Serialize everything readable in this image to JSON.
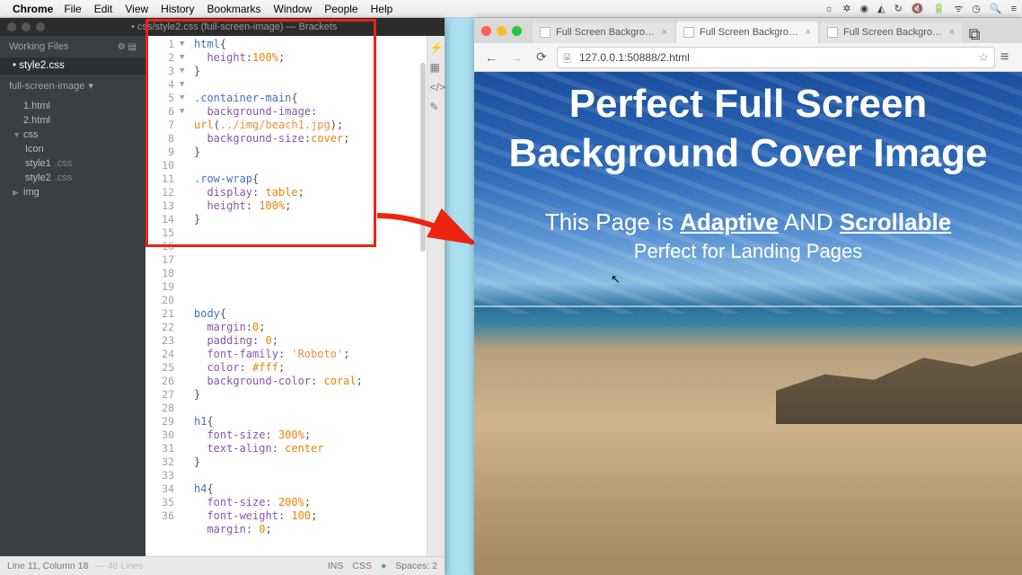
{
  "menubar": {
    "appname": "Chrome",
    "items": [
      "File",
      "Edit",
      "View",
      "History",
      "Bookmarks",
      "Window",
      "People",
      "Help"
    ]
  },
  "brackets": {
    "title": "• css/style2.css (full-screen-image) — Brackets",
    "workingFilesLabel": "Working Files",
    "workingFiles": [
      {
        "name": "style2.css",
        "modified": true
      }
    ],
    "projectName": "full-screen-image",
    "tree": [
      {
        "label": "1.html",
        "indent": 0
      },
      {
        "label": "2.html",
        "indent": 0
      },
      {
        "label": "css",
        "indent": 0,
        "folder": true,
        "open": true
      },
      {
        "label": "Icon",
        "indent": 1
      },
      {
        "label": "style1.css",
        "indent": 1,
        "dim": ".css"
      },
      {
        "label": "style2.css",
        "indent": 1,
        "dim": ".css"
      },
      {
        "label": "img",
        "indent": 0,
        "folder": true,
        "open": false
      }
    ],
    "statusbar": {
      "pos": "Line 11, Column 18",
      "lines": "— 46 Lines",
      "ins": "INS",
      "lang": "CSS",
      "spaces": "Spaces: 2"
    },
    "code": {
      "lines": [
        {
          "n": 1,
          "fold": "▼",
          "html": "<span class='sel'>html</span><span class='brace'>{</span>"
        },
        {
          "n": 2,
          "html": "  <span class='prop'>height</span>:<span class='val'>100%</span>;"
        },
        {
          "n": 3,
          "html": "<span class='brace'>}</span>"
        },
        {
          "n": 4,
          "html": ""
        },
        {
          "n": 5,
          "fold": "▼",
          "html": "<span class='sel'>.container-main</span><span class='brace'>{</span>"
        },
        {
          "n": 6,
          "html": "  <span class='prop'>background-image</span>:"
        },
        {
          "n": "",
          "html": "<span class='val'>url</span>(<span class='str'>../img/beach1.jpg</span>);"
        },
        {
          "n": 7,
          "html": "  <span class='prop'>background-size</span>:<span class='val'>cover</span>;"
        },
        {
          "n": 8,
          "html": "<span class='brace'>}</span>"
        },
        {
          "n": 9,
          "html": ""
        },
        {
          "n": 10,
          "fold": "▼",
          "html": "<span class='sel'>.row-wrap</span><span class='brace'>{</span>"
        },
        {
          "n": 11,
          "html": "  <span class='prop'>display</span>: <span class='val'>table</span>;"
        },
        {
          "n": 12,
          "html": "  <span class='prop'>height</span>: <span class='val'>100%</span>;"
        },
        {
          "n": 13,
          "html": "<span class='brace'>}</span>"
        },
        {
          "n": 14,
          "html": ""
        },
        {
          "n": 15,
          "html": ""
        },
        {
          "n": 16,
          "html": ""
        },
        {
          "n": 17,
          "html": ""
        },
        {
          "n": 18,
          "html": ""
        },
        {
          "n": 19,
          "html": ""
        },
        {
          "n": 20,
          "fold": "▼",
          "html": "<span class='sel'>body</span><span class='brace'>{</span>"
        },
        {
          "n": 21,
          "html": "  <span class='prop'>margin</span>:<span class='val'>0</span>;"
        },
        {
          "n": 22,
          "html": "  <span class='prop'>padding</span>: <span class='val'>0</span>;"
        },
        {
          "n": 23,
          "html": "  <span class='prop'>font-family</span>: <span class='str'>'Roboto'</span>;"
        },
        {
          "n": 24,
          "html": "  <span class='prop'>color</span>: <span class='val'>#fff</span>;"
        },
        {
          "n": 25,
          "html": "  <span class='prop'>background-color</span>: <span class='val'>coral</span>;"
        },
        {
          "n": 26,
          "html": "<span class='brace'>}</span>"
        },
        {
          "n": 27,
          "html": ""
        },
        {
          "n": 28,
          "fold": "▼",
          "html": "<span class='sel'>h1</span><span class='brace'>{</span>"
        },
        {
          "n": 29,
          "html": "  <span class='prop'>font-size</span>: <span class='val'>300%</span>;"
        },
        {
          "n": 30,
          "html": "  <span class='prop'>text-align</span>: <span class='val'>center</span>"
        },
        {
          "n": 31,
          "html": "<span class='brace'>}</span>"
        },
        {
          "n": 32,
          "html": ""
        },
        {
          "n": 33,
          "fold": "▼",
          "html": "<span class='sel'>h4</span><span class='brace'>{</span>"
        },
        {
          "n": 34,
          "html": "  <span class='prop'>font-size</span>: <span class='val'>200%</span>;"
        },
        {
          "n": 35,
          "html": "  <span class='prop'>font-weight</span>: <span class='val'>100</span>;"
        },
        {
          "n": 36,
          "html": "  <span class='prop'>margin</span>: <span class='val'>0</span>;"
        }
      ]
    }
  },
  "chrome": {
    "tabs": [
      "Full Screen Background",
      "Full Screen Background",
      "Full Screen Background"
    ],
    "activeTab": 1,
    "url": "127.0.0.1:50888/2.html",
    "hero": {
      "h1a": "Perfect Full Screen",
      "h1b": "Background Cover Image",
      "h4_pre": "This Page is ",
      "h4_u1": "Adaptive",
      "h4_mid": " AND ",
      "h4_u2": "Scrollable",
      "sub": "Perfect for Landing Pages"
    }
  }
}
